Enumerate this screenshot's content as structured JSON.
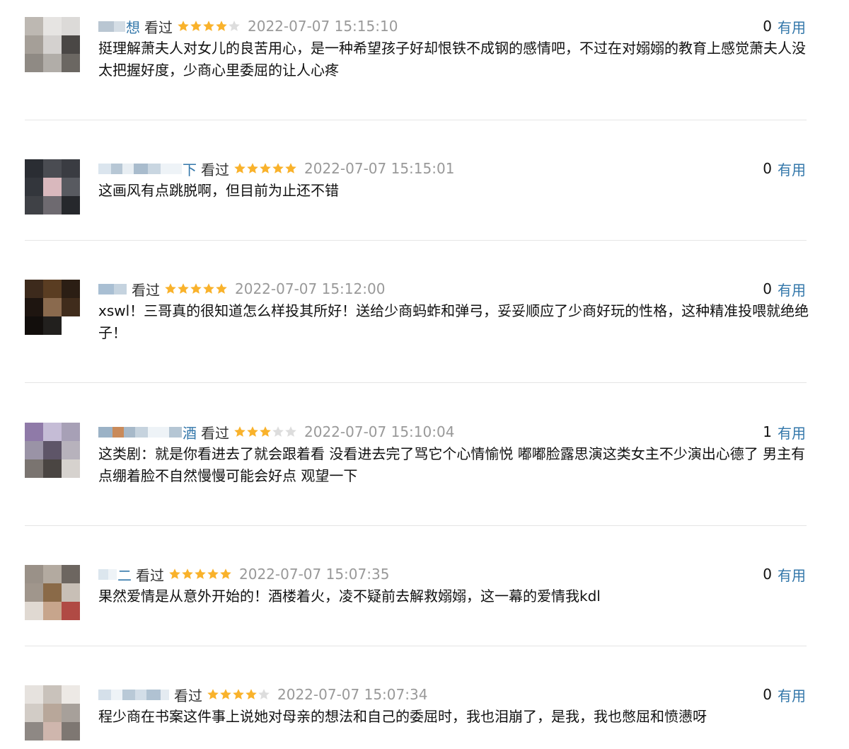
{
  "comments": [
    {
      "username_visible": "想",
      "status": "看过",
      "rating": 4,
      "time": "2022-07-07 15:15:10",
      "votes": "0",
      "useful_label": "有用",
      "content": "挺理解萧夫人对女儿的良苦用心，是一种希望孩子好却恨铁不成钢的感情吧，不过在对嫋嫋的教育上感觉萧夫人没太把握好度，少商心里委屈的让人心疼"
    },
    {
      "username_visible": "下",
      "status": "看过",
      "rating": 5,
      "time": "2022-07-07 15:15:01",
      "votes": "0",
      "useful_label": "有用",
      "content": "这画风有点跳脱啊，但目前为止还不错"
    },
    {
      "username_visible": "",
      "status": "看过",
      "rating": 5,
      "time": "2022-07-07 15:12:00",
      "votes": "0",
      "useful_label": "有用",
      "content": "xswl！三哥真的很知道怎么样投其所好！送给少商蚂蚱和弹弓，妥妥顺应了少商好玩的性格，这种精准投喂就绝绝子！"
    },
    {
      "username_visible": "酒",
      "status": "看过",
      "rating": 3,
      "time": "2022-07-07 15:10:04",
      "votes": "1",
      "useful_label": "有用",
      "content": "这类剧：就是你看进去了就会跟着看 没看进去完了骂它个心情愉悦 嘟嘟脸露思演这类女主不少演出心德了 男主有点绷着脸不自然慢慢可能会好点 观望一下"
    },
    {
      "username_visible": "二",
      "status": "看过",
      "rating": 5,
      "time": "2022-07-07 15:07:35",
      "votes": "0",
      "useful_label": "有用",
      "content": "果然爱情是从意外开始的！酒楼着火，凌不疑前去解救嫋嫋，这一幕的爱情我kdl"
    },
    {
      "username_visible": "",
      "status": "看过",
      "rating": 4,
      "time": "2022-07-07 15:07:34",
      "votes": "0",
      "useful_label": "有用",
      "content": "程少商在书案这件事上说她对母亲的想法和自己的委屈时，我也泪崩了，是我，我也憋屈和愤懑呀"
    }
  ],
  "colors": {
    "link": "#3377aa",
    "time": "#999999",
    "star_on": "#f9b22b",
    "star_off": "#dddddd",
    "divider": "#e5e5e5"
  }
}
